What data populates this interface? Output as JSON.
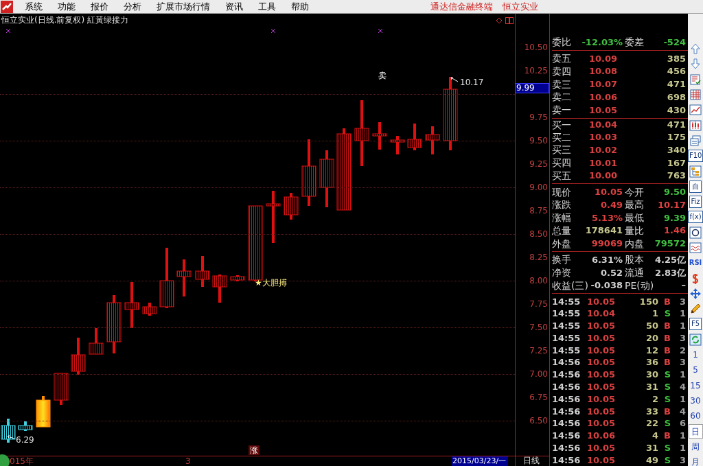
{
  "menu": {
    "items": [
      "系统",
      "功能",
      "报价",
      "分析",
      "扩展市场行情",
      "资讯",
      "工具",
      "帮助"
    ],
    "right": [
      "通达信金融终端",
      "恒立实业"
    ]
  },
  "chart": {
    "title": "恒立实业(日线.前复权) 紅黃绿接力",
    "sell_mark": "卖",
    "high_label": "10.17",
    "low_label": "6.29",
    "signal": "★大胆搏",
    "rise_mark": "涨",
    "last_price": "9.99",
    "price_axis": [
      "10.50",
      "10.25",
      "9.75",
      "9.50",
      "9.25",
      "9.00",
      "8.75",
      "8.50",
      "8.25",
      "8.00",
      "7.75",
      "7.50",
      "7.25",
      "7.00",
      "6.75",
      "6.50"
    ],
    "time_axis": {
      "year": "015年",
      "month": "3",
      "date": "2015/03/23/一",
      "period": "日线"
    }
  },
  "quote": {
    "ratio": [
      {
        "label": "委比",
        "value": "-12.03%",
        "color": "#40c040"
      },
      {
        "label": "委差",
        "value": "-524",
        "color": "#40c040"
      }
    ],
    "sell": [
      {
        "label": "卖五",
        "price": "10.09",
        "volume": "385"
      },
      {
        "label": "卖四",
        "price": "10.08",
        "volume": "456"
      },
      {
        "label": "卖三",
        "price": "10.07",
        "volume": "471"
      },
      {
        "label": "卖二",
        "price": "10.06",
        "volume": "698"
      },
      {
        "label": "卖一",
        "price": "10.05",
        "volume": "430"
      }
    ],
    "buy": [
      {
        "label": "买一",
        "price": "10.04",
        "volume": "471"
      },
      {
        "label": "买二",
        "price": "10.03",
        "volume": "175"
      },
      {
        "label": "买三",
        "price": "10.02",
        "volume": "340"
      },
      {
        "label": "买四",
        "price": "10.01",
        "volume": "167"
      },
      {
        "label": "买五",
        "price": "10.00",
        "volume": "763"
      }
    ],
    "stats": [
      [
        {
          "label": "现价",
          "value": "10.05",
          "color": "#e04040"
        },
        {
          "label": "今开",
          "value": "9.50",
          "color": "#40c040"
        }
      ],
      [
        {
          "label": "涨跌",
          "value": "0.49",
          "color": "#e04040"
        },
        {
          "label": "最高",
          "value": "10.17",
          "color": "#e04040"
        }
      ],
      [
        {
          "label": "涨幅",
          "value": "5.13%",
          "color": "#e04040"
        },
        {
          "label": "最低",
          "value": "9.39",
          "color": "#40c040"
        }
      ],
      [
        {
          "label": "总量",
          "value": "178641",
          "color": "#c8c890"
        },
        {
          "label": "量比",
          "value": "1.46",
          "color": "#e04040"
        }
      ],
      [
        {
          "label": "外盘",
          "value": "99069",
          "color": "#e04040"
        },
        {
          "label": "内盘",
          "value": "79572",
          "color": "#40c040"
        }
      ]
    ],
    "finance": [
      [
        {
          "label": "换手",
          "value": "6.31%",
          "color": "#d0d0d0"
        },
        {
          "label": "股本",
          "value": "4.25亿",
          "color": "#d0d0d0"
        }
      ],
      [
        {
          "label": "净资",
          "value": "0.52",
          "color": "#d0d0d0"
        },
        {
          "label": "流通",
          "value": "2.83亿",
          "color": "#d0d0d0"
        }
      ],
      [
        {
          "label": "收益(三)",
          "value": "-0.038",
          "color": "#d0d0d0"
        },
        {
          "label": "PE(动)",
          "value": "–",
          "color": "#d0d0d0"
        }
      ]
    ],
    "ticks": [
      {
        "time": "14:55",
        "price": "10.05",
        "volume": "150",
        "side": "B",
        "color": "#e04040",
        "count": "3"
      },
      {
        "time": "14:55",
        "price": "10.04",
        "volume": "1",
        "side": "S",
        "color": "#40c040",
        "count": "1"
      },
      {
        "time": "14:55",
        "price": "10.05",
        "volume": "50",
        "side": "B",
        "color": "#e04040",
        "count": "1"
      },
      {
        "time": "14:55",
        "price": "10.05",
        "volume": "20",
        "side": "B",
        "color": "#e04040",
        "count": "3"
      },
      {
        "time": "14:55",
        "price": "10.05",
        "volume": "12",
        "side": "B",
        "color": "#e04040",
        "count": "2"
      },
      {
        "time": "14:56",
        "price": "10.05",
        "volume": "36",
        "side": "B",
        "color": "#e04040",
        "count": "3"
      },
      {
        "time": "14:56",
        "price": "10.05",
        "volume": "30",
        "side": "S",
        "color": "#40c040",
        "count": "1"
      },
      {
        "time": "14:56",
        "price": "10.05",
        "volume": "31",
        "side": "S",
        "color": "#40c040",
        "count": "4"
      },
      {
        "time": "14:56",
        "price": "10.05",
        "volume": "2",
        "side": "S",
        "color": "#40c040",
        "count": "1"
      },
      {
        "time": "14:56",
        "price": "10.05",
        "volume": "33",
        "side": "B",
        "color": "#e04040",
        "count": "4"
      },
      {
        "time": "14:56",
        "price": "10.05",
        "volume": "22",
        "side": "S",
        "color": "#40c040",
        "count": "6"
      },
      {
        "time": "14:56",
        "price": "10.06",
        "volume": "4",
        "side": "B",
        "color": "#e04040",
        "count": "1"
      },
      {
        "time": "14:56",
        "price": "10.05",
        "volume": "31",
        "side": "S",
        "color": "#40c040",
        "count": "1"
      },
      {
        "time": "14:56",
        "price": "10.05",
        "volume": "49",
        "side": "S",
        "color": "#40c040",
        "count": "3"
      }
    ]
  },
  "toolbar": [
    {
      "kind": "up"
    },
    {
      "kind": "down"
    },
    {
      "kind": "list"
    },
    {
      "kind": "grid"
    },
    {
      "kind": "line"
    },
    {
      "kind": "candles"
    },
    {
      "kind": "windows"
    },
    {
      "kind": "text",
      "label": "F10"
    },
    {
      "kind": "tree"
    },
    {
      "kind": "text",
      "label": "自"
    },
    {
      "kind": "text",
      "label": "Fiz"
    },
    {
      "kind": "text",
      "label": "f(x)"
    },
    {
      "kind": "circle"
    },
    {
      "kind": "wave"
    },
    {
      "kind": "bare",
      "label": "RSI"
    },
    {
      "kind": "dollar"
    },
    {
      "kind": "move"
    },
    {
      "kind": "pencil"
    },
    {
      "kind": "text",
      "label": "F5"
    },
    {
      "kind": "refresh"
    },
    {
      "kind": "period",
      "label": "1",
      "selected": false
    },
    {
      "kind": "period",
      "label": "5",
      "selected": false
    },
    {
      "kind": "period",
      "label": "15",
      "selected": false
    },
    {
      "kind": "period",
      "label": "30",
      "selected": false
    },
    {
      "kind": "period",
      "label": "60",
      "selected": false
    },
    {
      "kind": "period",
      "label": "日",
      "selected": true
    },
    {
      "kind": "period",
      "label": "周",
      "selected": false
    },
    {
      "kind": "period",
      "label": "月",
      "selected": false
    }
  ]
}
